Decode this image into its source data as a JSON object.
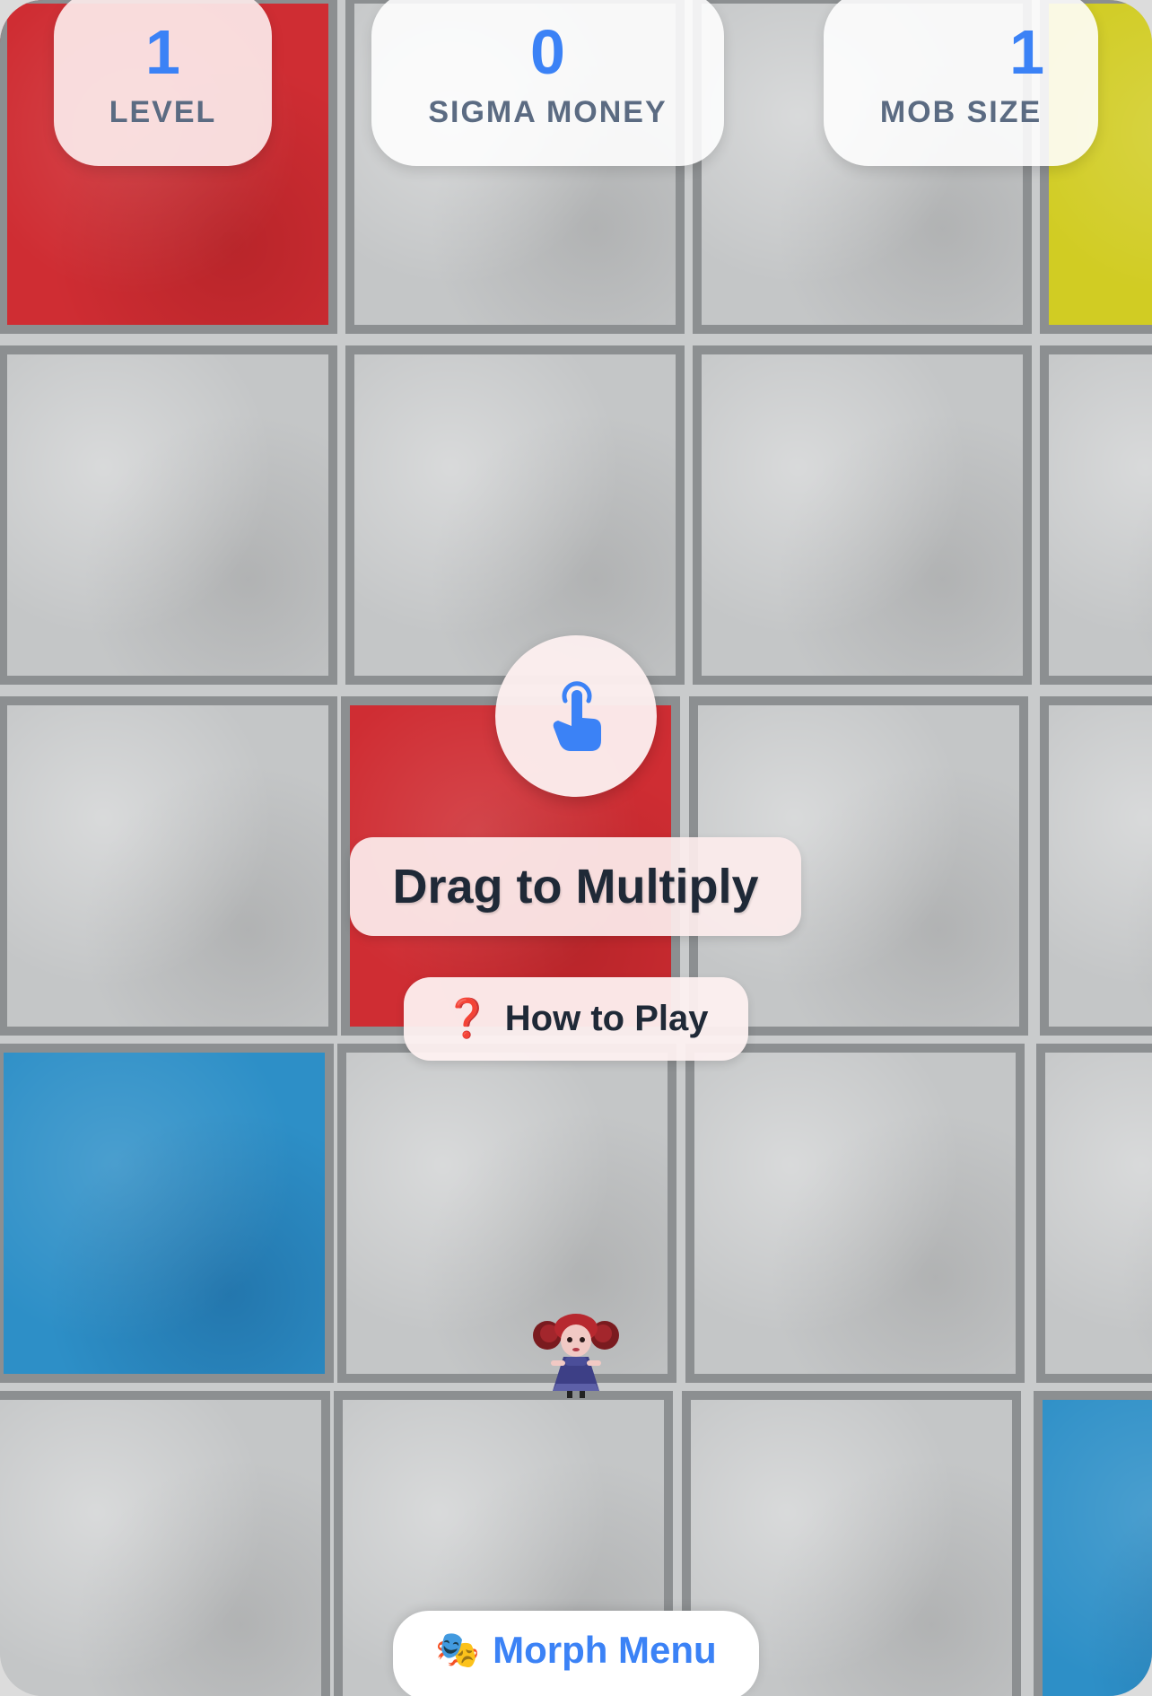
{
  "hud": {
    "level": {
      "value": "1",
      "label": "LEVEL"
    },
    "sigma_money": {
      "value": "0",
      "label": "SIGMA MONEY"
    },
    "mob_size": {
      "value": "1",
      "label": "MOB SIZE"
    }
  },
  "center": {
    "drag_label": "Drag to Multiply",
    "how_to_play": {
      "icon": "❓",
      "label": "How to Play"
    }
  },
  "bottom": {
    "morph_menu": {
      "icon": "🎭",
      "label": "Morph Menu"
    }
  },
  "icons": {
    "tap": "pointing-finger-icon",
    "character": "doll-character"
  },
  "colors": {
    "accent": "#3b82f6",
    "tile_red": "#cf2d33",
    "tile_blue": "#2d8fc7",
    "tile_yellow": "#d1cc23",
    "tile_gray": "#c4c6c7",
    "grout": "#8c8f91"
  }
}
